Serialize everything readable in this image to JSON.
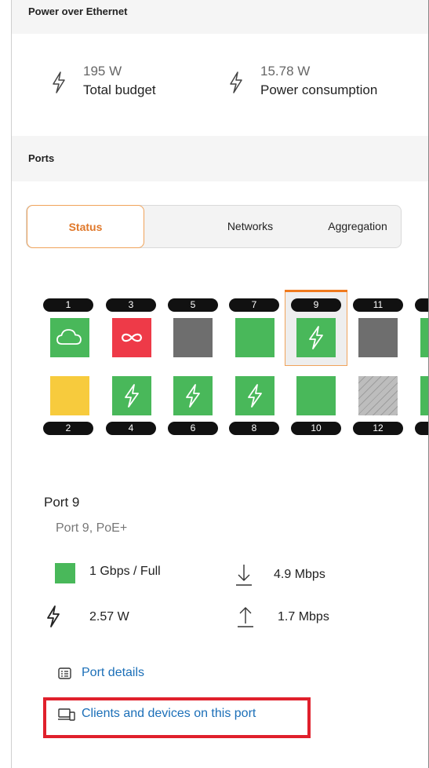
{
  "poe": {
    "title": "Power over Ethernet",
    "total_budget_value": "195 W",
    "total_budget_label": "Total budget",
    "consumption_value": "15.78 W",
    "consumption_label": "Power consumption"
  },
  "ports": {
    "title": "Ports",
    "tabs": [
      "Status",
      "Networks",
      "Aggregation"
    ],
    "active_tab": "Status",
    "top_row": [
      {
        "label": "1",
        "status": "connected-uplink",
        "color": "#49b85a",
        "icon": "cloud-icon"
      },
      {
        "label": "3",
        "status": "loop",
        "color": "#ee3a48",
        "icon": "infinity-icon"
      },
      {
        "label": "5",
        "status": "disabled",
        "color": "#6e6e6e",
        "icon": ""
      },
      {
        "label": "7",
        "status": "connected",
        "color": "#49b85a",
        "icon": ""
      },
      {
        "label": "9",
        "status": "poe",
        "color": "#49b85a",
        "icon": "bolt-icon",
        "selected": true
      },
      {
        "label": "11",
        "status": "disabled",
        "color": "#6e6e6e",
        "icon": ""
      },
      {
        "label": "",
        "status": "connected",
        "color": "#49b85a",
        "icon": ""
      }
    ],
    "bottom_row": [
      {
        "label": "2",
        "status": "warning",
        "color": "#f7cb3d",
        "icon": ""
      },
      {
        "label": "4",
        "status": "poe",
        "color": "#49b85a",
        "icon": "bolt-icon"
      },
      {
        "label": "6",
        "status": "poe",
        "color": "#49b85a",
        "icon": "bolt-icon"
      },
      {
        "label": "8",
        "status": "poe",
        "color": "#49b85a",
        "icon": "bolt-icon"
      },
      {
        "label": "10",
        "status": "connected",
        "color": "#49b85a",
        "icon": ""
      },
      {
        "label": "12",
        "status": "not-connected",
        "color": "#b0b0b0",
        "icon": "hatched"
      },
      {
        "label": "",
        "status": "connected",
        "color": "#49b85a",
        "icon": ""
      }
    ]
  },
  "port_detail": {
    "title": "Port 9",
    "subtitle": "Port 9, PoE+",
    "speed": "1 Gbps / Full",
    "download": "4.9 Mbps",
    "power": "2.57 W",
    "upload": "1.7 Mbps",
    "details_link": "Port details",
    "clients_link": "Clients and devices on this port"
  },
  "colors": {
    "accent": "#f0a35a",
    "link": "#1b6fb8",
    "status_green": "#49b85a",
    "status_red": "#ee3a48",
    "status_gray": "#6e6e6e",
    "status_yellow": "#f7cb3d",
    "highlight": "#e0202c"
  }
}
